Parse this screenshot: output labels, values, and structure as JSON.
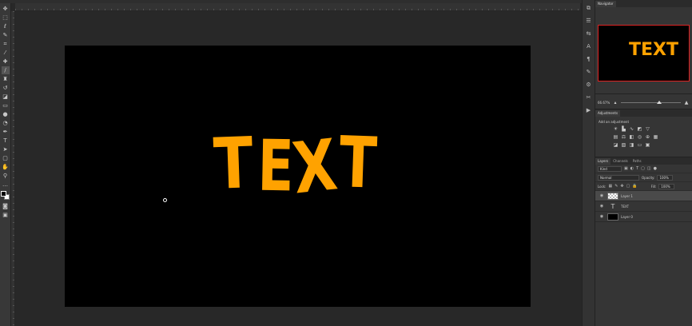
{
  "canvas": {
    "text_letters": [
      "T",
      "E",
      "X",
      "T"
    ],
    "text_color": "#ffa200",
    "background": "#000000"
  },
  "panels": {
    "navigator": {
      "tab": "Navigator",
      "thumb_text": "TEXT",
      "zoom": "66.67%"
    },
    "adjustments": {
      "tab": "Adjustments",
      "title": "Add an adjustment"
    },
    "layers": {
      "tabs": [
        "Layers",
        "Channels",
        "Paths"
      ],
      "filter_kind": "Kind",
      "blend_mode": "Normal",
      "opacity_label": "Opacity:",
      "opacity_value": "100%",
      "lock_label": "Lock:",
      "fill_label": "Fill:",
      "fill_value": "100%",
      "items": [
        {
          "name": "Layer 1",
          "selected": true
        },
        {
          "name": "TEXT",
          "selected": false
        },
        {
          "name": "Layer 0",
          "selected": false
        }
      ]
    }
  },
  "toolbar": {
    "icons": [
      "move-icon",
      "marquee-icon",
      "lasso-icon",
      "quick-select-icon",
      "crop-icon",
      "eyedropper-icon",
      "healing-icon",
      "brush-icon",
      "stamp-icon",
      "history-brush-icon",
      "eraser-icon",
      "gradient-icon",
      "blur-icon",
      "dodge-icon",
      "pen-icon",
      "type-icon",
      "path-select-icon",
      "shape-icon",
      "hand-icon",
      "zoom-icon",
      "more-icon"
    ]
  }
}
